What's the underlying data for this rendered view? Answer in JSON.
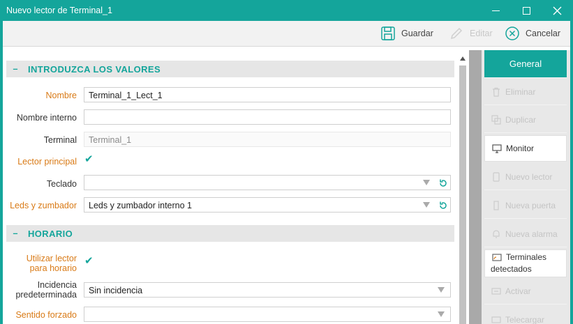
{
  "window": {
    "title": "Nuevo lector de Terminal_1"
  },
  "toolbar": {
    "save_label": "Guardar",
    "edit_label": "Editar",
    "cancel_label": "Cancelar"
  },
  "sections": {
    "values_title": "INTRODUZCA LOS VALORES",
    "schedule_title": "HORARIO",
    "toggle": "–"
  },
  "form": {
    "nombre_label": "Nombre",
    "nombre_value": "Terminal_1_Lect_1",
    "nombre_interno_label": "Nombre interno",
    "nombre_interno_value": "",
    "terminal_label": "Terminal",
    "terminal_value": "Terminal_1",
    "lector_principal_label": "Lector principal",
    "lector_principal_checked": true,
    "teclado_label": "Teclado",
    "teclado_value": "",
    "leds_label": "Leds y zumbador",
    "leds_value": "Leds y zumbador interno 1",
    "utilizar_label_1": "Utilizar lector",
    "utilizar_label_2": "para horario",
    "utilizar_checked": true,
    "incidencia_label_1": "Incidencia",
    "incidencia_label_2": "predeterminada",
    "incidencia_value": "Sin incidencia",
    "sentido_label": "Sentido forzado",
    "sentido_value": ""
  },
  "sidebar": {
    "items": [
      {
        "label": "General",
        "state": "selected"
      },
      {
        "label": "Eliminar",
        "state": "disabled"
      },
      {
        "label": "Duplicar",
        "state": "disabled"
      },
      {
        "label": "Monitor",
        "state": "enabled"
      },
      {
        "label": "Nuevo lector",
        "state": "disabled"
      },
      {
        "label": "Nueva puerta",
        "state": "disabled"
      },
      {
        "label": "Nueva alarma",
        "state": "disabled"
      },
      {
        "label_1": "Terminales",
        "label_2": "detectados",
        "state": "enabled"
      },
      {
        "label": "Activar",
        "state": "disabled"
      },
      {
        "label": "Telecargar",
        "state": "disabled"
      }
    ]
  },
  "colors": {
    "accent": "#14a59b",
    "required_label": "#d97a16",
    "disabled_text": "#c4c4c4"
  }
}
